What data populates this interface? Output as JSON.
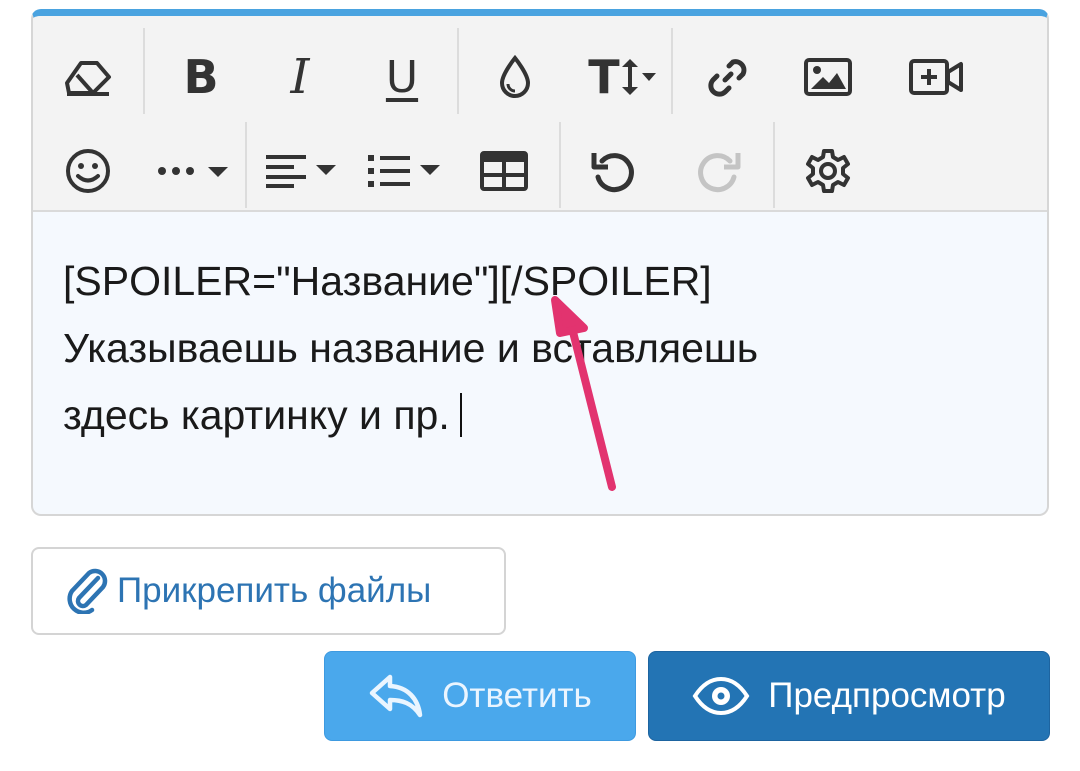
{
  "editor": {
    "accent_color": "#4aa3e0",
    "toolbar_row1": [
      {
        "icon": "eraser-icon",
        "label": ""
      },
      {
        "icon": "bold-icon",
        "label": "B"
      },
      {
        "icon": "italic-icon",
        "label": "I"
      },
      {
        "icon": "underline-icon",
        "label": "U"
      },
      {
        "icon": "text-color-drop-icon",
        "label": ""
      },
      {
        "icon": "font-size-icon",
        "label": "T"
      },
      {
        "icon": "link-icon",
        "label": ""
      },
      {
        "icon": "image-icon",
        "label": ""
      },
      {
        "icon": "video-icon",
        "label": ""
      }
    ],
    "toolbar_row2": [
      {
        "icon": "smiley-icon"
      },
      {
        "icon": "more-dots-icon"
      },
      {
        "icon": "align-icon"
      },
      {
        "icon": "list-icon"
      },
      {
        "icon": "table-icon"
      },
      {
        "icon": "undo-icon"
      },
      {
        "icon": "redo-icon"
      },
      {
        "icon": "gear-icon"
      }
    ],
    "content_lines": [
      "[SPOILER=\"Название\"][/SPOILER]",
      "Указываешь название и вставляешь",
      "здесь картинку и пр."
    ],
    "annotation_arrow_color": "#e2336f"
  },
  "attach": {
    "label": "Прикрепить файлы",
    "color": "#2d74b3"
  },
  "actions": {
    "reply_label": "Ответить",
    "reply_color": "#4aa8ec",
    "preview_label": "Предпросмотр",
    "preview_color": "#2374b4"
  }
}
